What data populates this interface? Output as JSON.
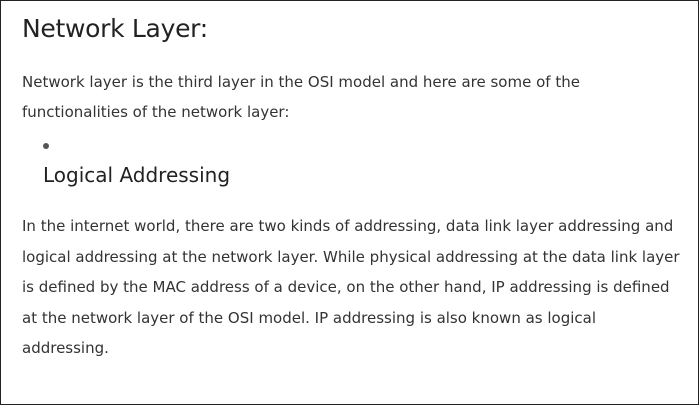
{
  "section": {
    "title": "Network Layer:",
    "intro": "Network layer is the third layer in the OSI model and here are some of the functionalities of the network layer:"
  },
  "list": {
    "items": [
      {
        "heading": "Logical Addressing"
      }
    ]
  },
  "body": {
    "paragraph": "In the internet world, there are two kinds of addressing, data link layer addressing and logical addressing at the network layer. While physical addressing at the data link layer is defined by the MAC address of a device, on the other hand, IP addressing is defined at the network layer of the OSI model. IP addressing is also known as logical addressing."
  }
}
